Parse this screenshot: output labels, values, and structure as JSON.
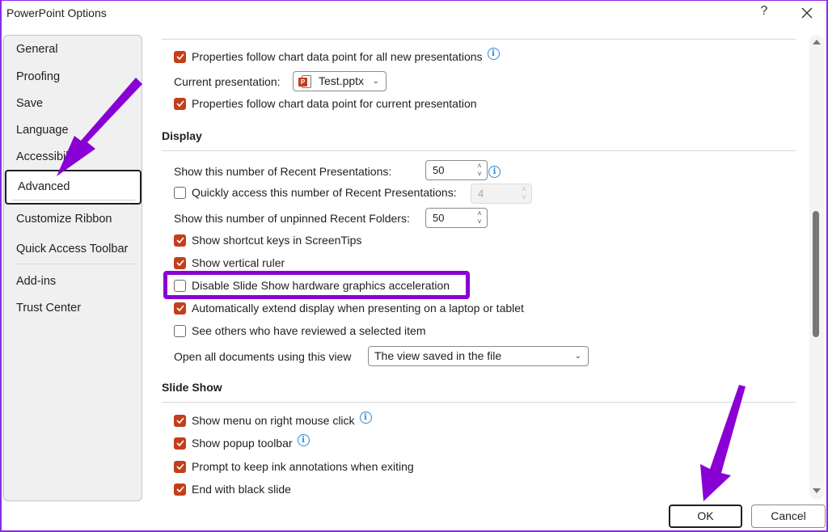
{
  "window": {
    "title": "PowerPoint Options",
    "help_label": "?",
    "close_icon": "close-icon"
  },
  "sidebar": {
    "items": [
      {
        "label": "General",
        "selected": false
      },
      {
        "label": "Proofing",
        "selected": false
      },
      {
        "label": "Save",
        "selected": false
      },
      {
        "label": "Language",
        "selected": false
      },
      {
        "label": "Accessibility",
        "selected": false
      },
      {
        "label": "Advanced",
        "selected": true
      },
      {
        "label": "Customize Ribbon",
        "selected": false
      },
      {
        "label": "Quick Access Toolbar",
        "selected": false
      },
      {
        "label": "Add-ins",
        "selected": false
      },
      {
        "label": "Trust Center",
        "selected": false
      }
    ]
  },
  "chart_section": {
    "props_all_new": {
      "label": "Properties follow chart data point for all new presentations",
      "checked": true,
      "info_icon": "info-icon"
    },
    "current_presentation_label": "Current presentation:",
    "current_presentation_value": "Test.pptx",
    "props_current": {
      "label": "Properties follow chart data point for current presentation",
      "checked": true
    }
  },
  "display": {
    "title": "Display",
    "recent_presentations_label": "Show this number of Recent Presentations:",
    "recent_presentations_value": "50",
    "quick_access": {
      "label": "Quickly access this number of Recent Presentations:",
      "checked": false,
      "value": "4"
    },
    "recent_folders_label": "Show this number of unpinned Recent Folders:",
    "recent_folders_value": "50",
    "shortcut_keys": {
      "label": "Show shortcut keys in ScreenTips",
      "checked": true
    },
    "vertical_ruler": {
      "label": "Show vertical ruler",
      "checked": true
    },
    "disable_hw_accel": {
      "label": "Disable Slide Show hardware graphics acceleration",
      "checked": false
    },
    "auto_extend": {
      "label": "Automatically extend display when presenting on a laptop or tablet",
      "checked": true
    },
    "see_others": {
      "label": "See others who have reviewed a selected item",
      "checked": false
    },
    "open_view_label": "Open all documents using this view",
    "open_view_value": "The view saved in the file"
  },
  "slideshow": {
    "title": "Slide Show",
    "items": [
      {
        "label": "Show menu on right mouse click",
        "checked": true,
        "info": true
      },
      {
        "label": "Show popup toolbar",
        "checked": true,
        "info": true
      },
      {
        "label": "Prompt to keep ink annotations when exiting",
        "checked": true,
        "info": false
      },
      {
        "label": "End with black slide",
        "checked": true,
        "info": false
      }
    ]
  },
  "footer": {
    "ok_label": "OK",
    "cancel_label": "Cancel"
  },
  "annotation": {
    "color": "#8a00d4"
  }
}
